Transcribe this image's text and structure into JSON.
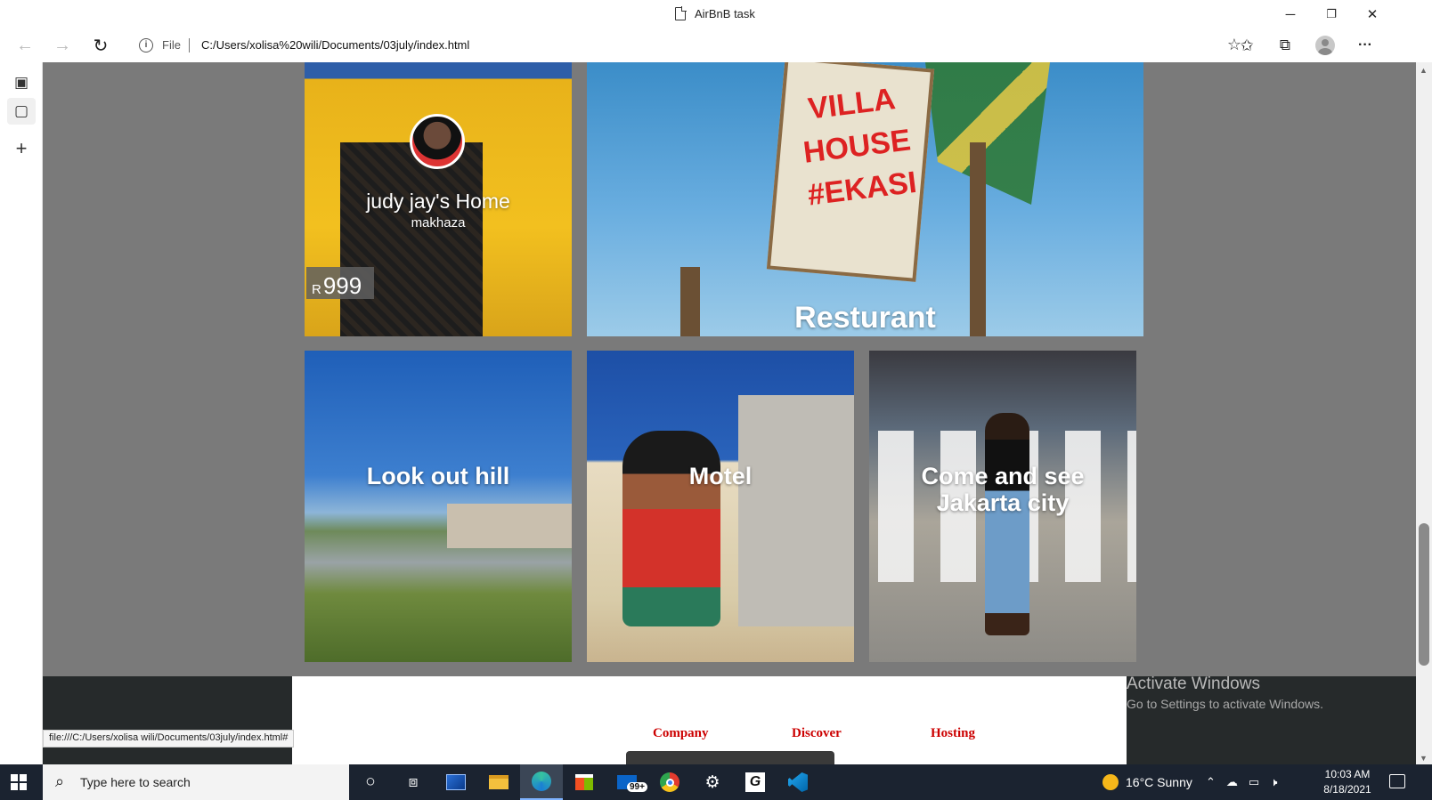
{
  "window": {
    "title": "AirBnB task",
    "controls": {
      "minimize": "─",
      "restore": "❐",
      "close": "✕"
    }
  },
  "addressbar": {
    "back_icon": "←",
    "forward_icon": "→",
    "refresh_icon": "↻",
    "info_icon": "i",
    "protocol_label": "File",
    "url": "C:/Users/xolisa%20wili/Documents/03july/index.html",
    "icons": {
      "favorite_add": "☆",
      "favorites": "✩",
      "collections": "⧉",
      "more": "···"
    }
  },
  "vertical_tabs": {
    "tabs_icon": "▣",
    "page_icon": "▢",
    "new_tab_icon": "+"
  },
  "listings": {
    "home": {
      "title": "judy jay's Home",
      "subtitle": "makhaza",
      "currency": "R",
      "price": "999"
    },
    "restaurant": {
      "caption": "Resturant",
      "sign_text": "VILLA HOUSE #EKASI"
    },
    "hill": {
      "caption": "Look out hill"
    },
    "motel": {
      "caption": "Motel"
    },
    "city": {
      "caption": "Come and see Jakarta city"
    }
  },
  "footer": {
    "columns": [
      "Company",
      "Discover",
      "Hosting"
    ]
  },
  "watermark": {
    "line1": "Activate Windows",
    "line2": "Go to Settings to activate Windows."
  },
  "status_url": "file:///C:/Users/xolisa wili/Documents/03july/index.html#",
  "taskbar": {
    "search_placeholder": "Type here to search",
    "mail_badge": "99+",
    "weather": "16°C  Sunny",
    "time": "10:03 AM",
    "date": "8/18/2021"
  },
  "colors": {
    "page_background": "#7a7a7a",
    "footer_link": "#cc0000",
    "taskbar": "#1b2330",
    "footer_dark": "#262a2b"
  }
}
